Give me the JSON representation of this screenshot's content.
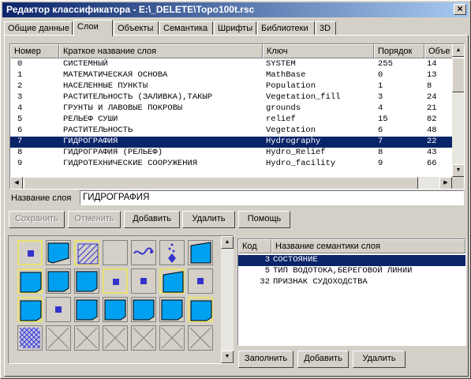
{
  "window": {
    "title": "Редактор классификатора - E:\\_DELETE\\Topo100t.rsc",
    "close_glyph": "×"
  },
  "tabs": [
    "Общие данные",
    "Слои",
    "Объекты",
    "Семантика",
    "Шрифты",
    "Библиотеки",
    "3D"
  ],
  "active_tab": 1,
  "layers_table": {
    "headers": [
      "Номер",
      "Краткое название слоя",
      "Ключ",
      "Порядок",
      "Объе"
    ],
    "rows": [
      [
        "0",
        "СИСТЕМНЫЙ",
        "SYSTEM",
        "255",
        "14"
      ],
      [
        "1",
        "МАТЕМАТИЧЕСКАЯ ОСНОВА",
        "MathBase",
        "0",
        "13"
      ],
      [
        "2",
        "НАСЕЛЕННЫЕ ПУНКТЫ",
        "Population",
        "1",
        "8"
      ],
      [
        "3",
        "РАСТИТЕЛЬНОСТЬ (ЗАЛИВКА),ТАКЫР",
        "Vegetation_fill",
        "3",
        "24"
      ],
      [
        "4",
        "ГРУНТЫ И ЛАВОВЫЕ ПОКРОВЫ",
        "grounds",
        "4",
        "21"
      ],
      [
        "5",
        "РЕЛЬЕФ СУШИ",
        "relief",
        "15",
        "82"
      ],
      [
        "6",
        "РАСТИТЕЛЬНОСТЬ",
        "Vegetation",
        "6",
        "48"
      ],
      [
        "7",
        "ГИДРОГРАФИЯ",
        "Hydrography",
        "7",
        "22"
      ],
      [
        "8",
        "ГИДРОГРАФИЯ (РЕЛЬЕФ)",
        "Hydro_Relief",
        "8",
        "43"
      ],
      [
        "9",
        "ГИДРОТЕХНИЧЕСКИЕ СООРУЖЕНИЯ",
        "Hydro_facility",
        "9",
        "66"
      ]
    ],
    "selected_row": 7
  },
  "layer_name": {
    "label": "Название слоя",
    "value": "ГИДРОГРАФИЯ"
  },
  "actions": {
    "save": "Сохранить",
    "cancel": "Отменить",
    "add": "Добавить",
    "delete": "Удалить",
    "help": "Помощь"
  },
  "semantics_table": {
    "headers": [
      "Код",
      "Название семантики слоя"
    ],
    "rows": [
      [
        "3",
        "СОСТОЯНИЕ"
      ],
      [
        "5",
        "ТИП ВОДОТОКА,БЕРЕГОВОЙ ЛИНИИ"
      ],
      [
        "32",
        "ПРИЗНАК СУДОХОДСТВА"
      ]
    ],
    "selected_row": 0
  },
  "semantics_actions": {
    "fill": "Заполнить",
    "add": "Добавить",
    "delete": "Удалить"
  },
  "colors": {
    "title_bar": "#0a246a",
    "selection": "#0a246a",
    "symbol_fill": "#00a0f0",
    "symbol_point": "#3333cc",
    "highlight": "#e8e070"
  },
  "symbol_tiles": [
    "point",
    "area-left",
    "hatched",
    "empty",
    "wave-line",
    "dots-vertical",
    "area-right",
    "area",
    "area",
    "area",
    "point",
    "point",
    "area-right",
    "point",
    "area",
    "point",
    "area",
    "area",
    "area",
    "area",
    "area",
    "crosshatch",
    "x-empty",
    "x-empty",
    "x-empty",
    "x-empty",
    "x-empty",
    "x-empty"
  ]
}
